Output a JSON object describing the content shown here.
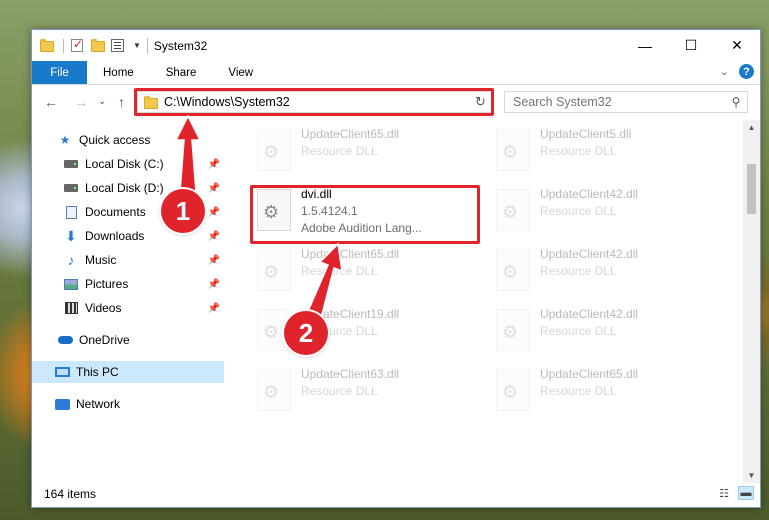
{
  "window": {
    "title": "System32",
    "controls": {
      "minimize": "—",
      "maximize": "☐",
      "close": "✕"
    }
  },
  "ribbon": {
    "tabs": [
      "File",
      "Home",
      "Share",
      "View"
    ],
    "help": "?",
    "collapse": "⌄"
  },
  "nav": {
    "back": "←",
    "forward": "→",
    "dropdown": "⌄",
    "up": "↑",
    "address": "C:\\Windows\\System32",
    "refresh": "↻",
    "search_placeholder": "Search System32"
  },
  "sidebar": {
    "items": [
      {
        "label": "Quick access",
        "icon": "star-icon",
        "pinned": false
      },
      {
        "label": "Local Disk (C:)",
        "icon": "drive-icon",
        "pinned": true
      },
      {
        "label": "Local Disk (D:)",
        "icon": "drive-icon",
        "pinned": true
      },
      {
        "label": "Documents",
        "icon": "documents-icon",
        "pinned": true
      },
      {
        "label": "Downloads",
        "icon": "downloads-icon",
        "pinned": true
      },
      {
        "label": "Music",
        "icon": "music-icon",
        "pinned": true
      },
      {
        "label": "Pictures",
        "icon": "pictures-icon",
        "pinned": true
      },
      {
        "label": "Videos",
        "icon": "videos-icon",
        "pinned": true
      },
      {
        "label": "OneDrive",
        "icon": "onedrive-icon",
        "pinned": false
      },
      {
        "label": "This PC",
        "icon": "this-pc-icon",
        "pinned": false,
        "selected": true
      },
      {
        "label": "Network",
        "icon": "network-icon",
        "pinned": false
      }
    ]
  },
  "files": {
    "left": [
      {
        "name": "UpdateClient65.dll",
        "type": "Resource DLL"
      },
      {
        "name": "dvi.dll",
        "version": "1.5.4124.1",
        "description": "Adobe Audition Lang..."
      },
      {
        "name": "UpdateClient65.dll",
        "type": "Resource DLL"
      },
      {
        "name": "UpdateClient19.dll",
        "type": "Resource DLL"
      },
      {
        "name": "UpdateClient63.dll",
        "type": "Resource DLL"
      }
    ],
    "right": [
      {
        "name": "UpdateClient5.dll",
        "type": "Resource DLL"
      },
      {
        "name": "UpdateClient42.dll",
        "type": "Resource DLL"
      },
      {
        "name": "UpdateClient42.dll",
        "type": "Resource DLL"
      },
      {
        "name": "UpdateClient42.dll",
        "type": "Resource DLL"
      },
      {
        "name": "UpdateClient65.dll",
        "type": "Resource DLL"
      }
    ]
  },
  "status": {
    "item_count": "164 items"
  },
  "annotations": {
    "step1": "1",
    "step2": "2"
  },
  "colors": {
    "accent": "#1979ca",
    "highlight": "#e0242c",
    "selected": "#cce8ff"
  }
}
